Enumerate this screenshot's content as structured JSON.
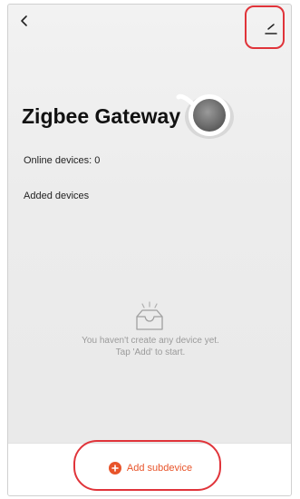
{
  "header": {
    "back_icon": "chevron-left-icon",
    "edit_icon": "pencil-edit-icon"
  },
  "device": {
    "title": "Zigbee Gateway",
    "online_label": "Online devices: 0",
    "added_label": "Added devices"
  },
  "empty_state": {
    "icon": "empty-box-icon",
    "line1": "You haven't create any device yet.",
    "line2": "Tap 'Add' to start."
  },
  "footer": {
    "add_icon": "plus-circle-icon",
    "add_label": "Add subdevice"
  },
  "colors": {
    "accent": "#e8542a",
    "highlight": "#e0343a",
    "background": "#ececec",
    "muted_text": "#9a9a9a"
  }
}
